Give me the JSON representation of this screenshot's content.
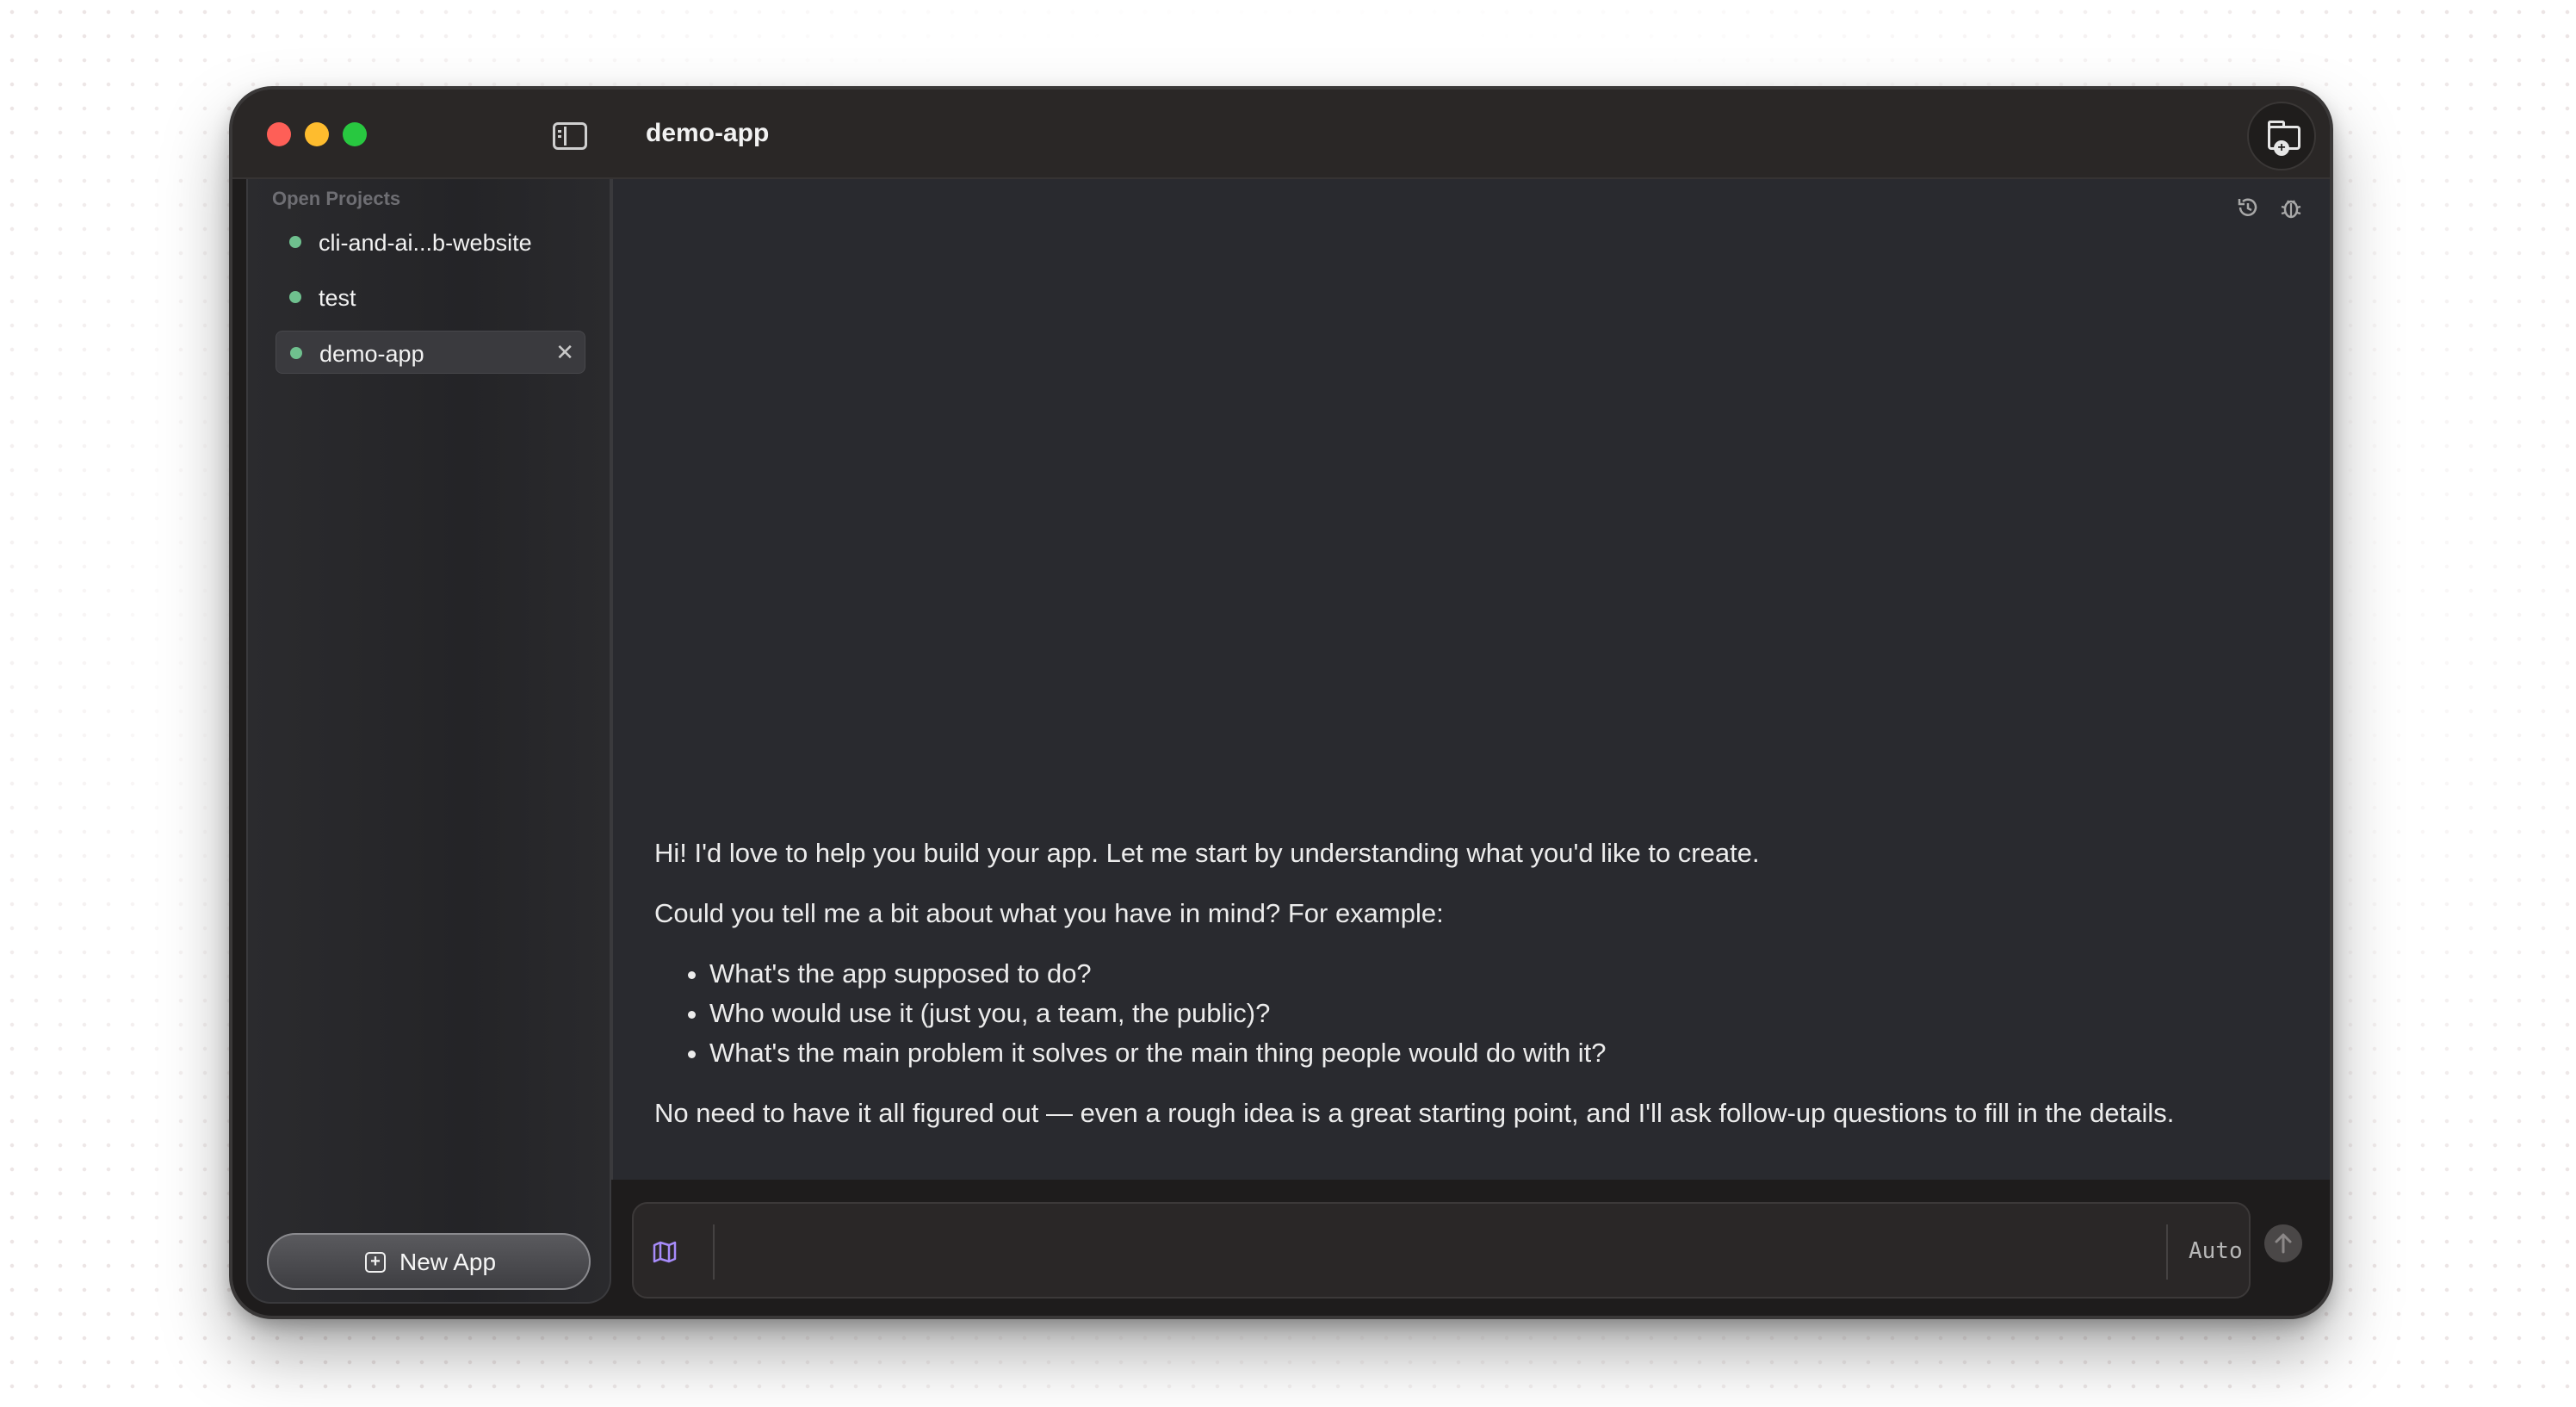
{
  "window": {
    "title": "demo-app"
  },
  "sidebar": {
    "heading": "Open Projects",
    "projects": [
      {
        "label": "cli-and-ai...b-website",
        "active": false
      },
      {
        "label": "test",
        "active": false
      },
      {
        "label": "demo-app",
        "active": true
      }
    ],
    "new_app_label": "New App"
  },
  "chat": {
    "intro": "Hi! I'd love to help you build your app. Let me start by understanding what you'd like to create.",
    "prompt": "Could you tell me a bit about what you have in mind? For example:",
    "questions": [
      "What's the app supposed to do?",
      "Who would use it (just you, a team, the public)?",
      "What's the main problem it solves or the main thing people would do with it?"
    ],
    "closing": "No need to have it all figured out — even a rough idea is a great starting point, and I'll ask follow-up questions to fill in the details."
  },
  "composer": {
    "value": "",
    "mode_label": "Auto"
  },
  "icons": {
    "sidebar_toggle": "sidebar-toggle-icon",
    "new_folder": "folder-plus-icon",
    "history": "history-icon",
    "bug": "bug-icon",
    "map": "map-icon",
    "send": "arrow-up-icon",
    "close": "close-icon",
    "new_app": "plus-square-icon"
  },
  "colors": {
    "status_dot": "#6fc08e",
    "accent_map_icon": "#a78bfa",
    "traffic_close": "#fe5f57",
    "traffic_minimize": "#febc2e",
    "traffic_maximize": "#28c840"
  }
}
